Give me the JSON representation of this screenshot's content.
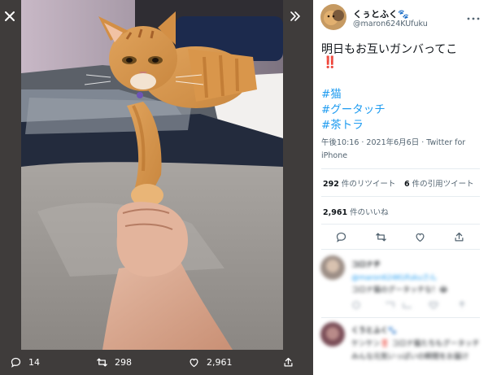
{
  "author": {
    "name": "くぅとふく🐾",
    "handle": "@maron624KUfuku"
  },
  "tweet": {
    "text": "明日もお互いガンバってこ",
    "emphasis": "‼️",
    "hashtags": [
      "#猫",
      "#グータッチ",
      "#茶トラ"
    ],
    "time": "午後10:16 · 2021年6月6日",
    "via": "Twitter for iPhone"
  },
  "stats": {
    "retweets_count": "292",
    "retweets_label": "件のリツイート",
    "quotes_count": "6",
    "quotes_label": "件の引用ツイート",
    "likes_count": "2,961",
    "likes_label": "件のいいね"
  },
  "viewer_bar": {
    "replies": "14",
    "retweets": "298",
    "likes": "2,961"
  },
  "replies": [
    {
      "name": "コロナチ",
      "line1": "@maron624KUfukuさん",
      "line2": "コロナ猫のグータッチな！😂"
    },
    {
      "name": "くうとふく🐾",
      "line1": "ケンケン‼️ コロナ猫たちもグータッチ",
      "line2": "みんな元気いっぱいの瞬間をお届け"
    }
  ],
  "colors": {
    "viewer_bg": "#3f3c3b",
    "link": "#1d9bf0",
    "text": "#0f1419",
    "secondary": "#536471",
    "emphasis": "#e0245e"
  },
  "icons": [
    "close-icon",
    "expand-icon",
    "reply-icon",
    "retweet-icon",
    "like-icon",
    "share-icon",
    "more-icon"
  ]
}
